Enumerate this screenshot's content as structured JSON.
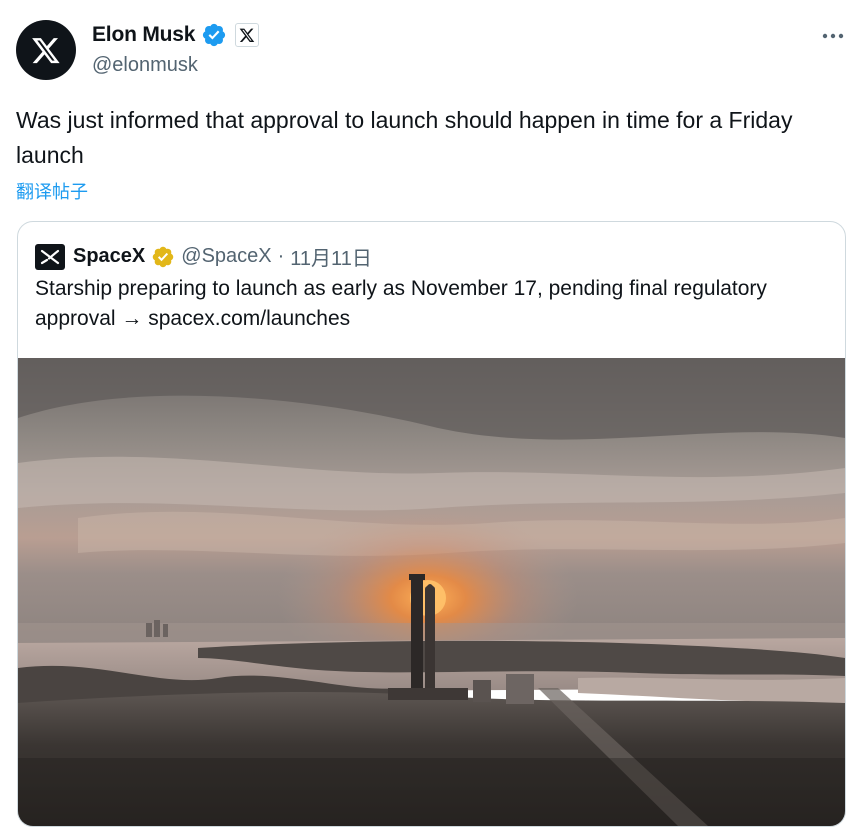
{
  "author": {
    "display_name": "Elon Musk",
    "handle": "@elonmusk",
    "verified_badge": "blue-check-icon",
    "affiliation_icon": "x-logo-icon",
    "avatar_icon": "x-logo-icon"
  },
  "menu": {
    "more_icon": "more-horizontal-icon"
  },
  "tweet": {
    "text": "Was just informed that approval to launch should happen in time for a Friday launch",
    "translate_label": "翻译帖子"
  },
  "quoted": {
    "display_name": "SpaceX",
    "handle": "@SpaceX",
    "separator": "·",
    "date": "11月11日",
    "badge": "gold-check-icon",
    "avatar_icon": "spacex-logo-icon",
    "text": "Starship preparing to launch as early as November 17, pending final regulatory approval → spacex.com/launches",
    "media": "starship-launch-tower-at-sunset-photo"
  },
  "colors": {
    "text_primary": "#0f1419",
    "text_secondary": "#536471",
    "link_blue": "#1d9bf0",
    "border": "#cfd9de",
    "verified_blue": "#1d9bf0",
    "verified_gold": "#e2b719"
  }
}
